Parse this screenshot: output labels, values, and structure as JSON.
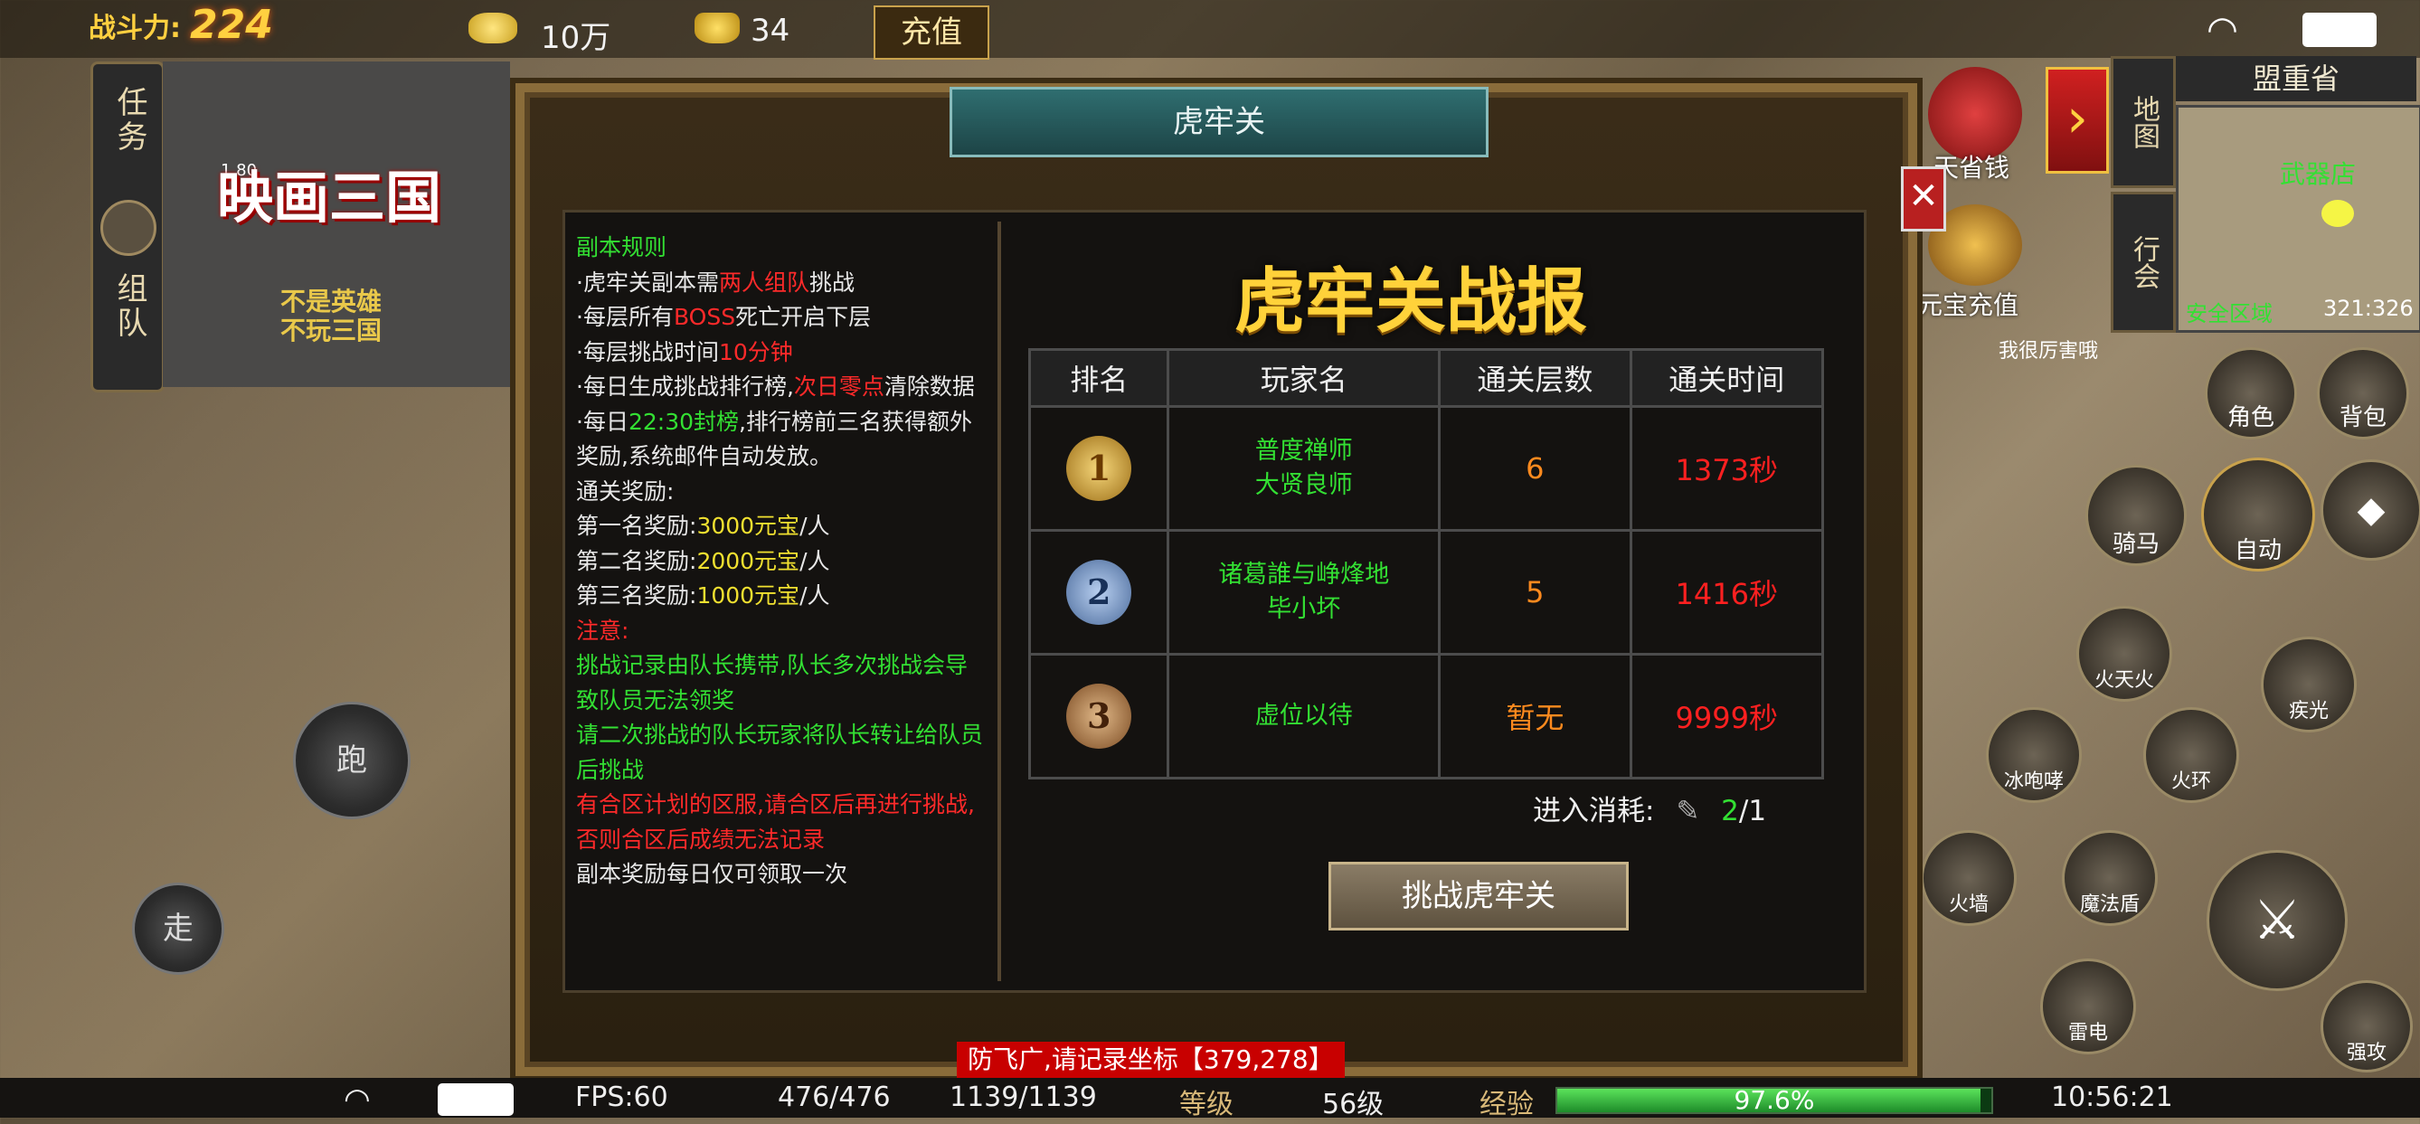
{
  "top": {
    "power_label": "战斗力:",
    "power_value": "224",
    "gold_amount": "10万",
    "ingot_amount": "34",
    "recharge_label": "充值"
  },
  "left": {
    "tab_task": "任务",
    "tab_team": "组队",
    "logo_title": "映画三国",
    "logo_version": "1.80",
    "logo_slogan_1": "不是英雄",
    "logo_slogan_2": "不玩三国",
    "run_label": "跑",
    "walk_label": "走"
  },
  "dialog": {
    "title": "虎牢关",
    "close": "✕",
    "rules": {
      "heading": "副本规则",
      "line1_a": "·虎牢关副本需",
      "line1_b": "两人组队",
      "line1_c": "挑战",
      "line2_a": "·每层所有",
      "line2_b": "BOSS",
      "line2_c": "死亡开启下层",
      "line3_a": "·每层挑战时间",
      "line3_b": "10分钟",
      "line4_a": "·每日生成挑战排行榜,",
      "line4_b": "次日零点",
      "line4_c": "清除数据",
      "line5_a": "·每日",
      "line5_b": "22:30封榜",
      "line5_c": ",排行榜前三名获得额外奖励,系统邮件自动发放。",
      "reward_heading": "通关奖励:",
      "reward1_a": "第一名奖励:",
      "reward1_b": "3000元宝",
      "reward1_c": "/人",
      "reward2_a": "第二名奖励:",
      "reward2_b": "2000元宝",
      "reward2_c": "/人",
      "reward3_a": "第三名奖励:",
      "reward3_b": "1000元宝",
      "reward3_c": "/人",
      "note_heading": "注意:",
      "note1": "挑战记录由队长携带,队长多次挑战会导致队员无法领奖",
      "note2": "请二次挑战的队长玩家将队长转让给队员后挑战",
      "note3": "有合区计划的区服,请合区后再进行挑战,否则合区后成绩无法记录",
      "note4": "副本奖励每日仅可领取一次"
    },
    "report": {
      "title": "虎牢关战报",
      "headers": [
        "排名",
        "玩家名",
        "通关层数",
        "通关时间"
      ],
      "rows": [
        {
          "rank": "1",
          "player1": "普度禅师",
          "player2": "大贤良师",
          "layers": "6",
          "time": "1373秒"
        },
        {
          "rank": "2",
          "player1": "诸葛誰与峥烽地",
          "player2": "毕小坏",
          "layers": "5",
          "time": "1416秒"
        },
        {
          "rank": "3",
          "player1": "虚位以待",
          "player2": "",
          "layers": "暂无",
          "time": "9999秒"
        }
      ],
      "cost_label": "进入消耗:",
      "cost_current": "2",
      "cost_total": "/1",
      "challenge_button": "挑战虎牢关"
    }
  },
  "right": {
    "region_name": "盟重省",
    "map_label": "地图",
    "shop_label": "武器店",
    "safe_zone": "安全区域",
    "coords": "321:326",
    "save_money": "天省钱",
    "ingot_recharge": "元宝充值",
    "retire_label": "行会",
    "role": "角色",
    "bag": "背包",
    "ride": "骑马",
    "auto": "自动",
    "skill_fire": "火天火",
    "skill_ice": "冰咆哮",
    "skill_flame": "火环",
    "skill_wall": "火墙",
    "skill_shield": "魔法盾",
    "skill_thunder": "雷电",
    "skill_attack": "强攻",
    "skill_light": "疾光",
    "npc_text": "我很厉害哦"
  },
  "bottom": {
    "fps": "FPS:60",
    "hp": "476/476",
    "mp": "1139/1139",
    "level_label": "等级",
    "level": "56级",
    "exp_label": "经验",
    "exp_percent": "97.6%",
    "exp_fraction": 0.976,
    "clock": "10:56:21",
    "chat_text": "防飞广,请记录坐标【379,278】"
  },
  "colors": {
    "ui_gold": "#ffd23a",
    "player_green": "#33e033",
    "time_red": "#ff2020",
    "layer_orange": "#ff8a1e"
  }
}
